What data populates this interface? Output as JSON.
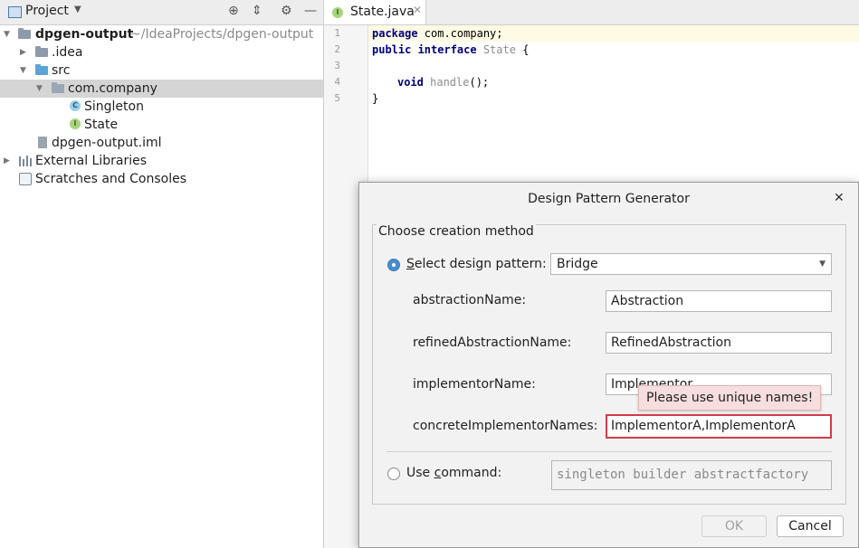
{
  "project_panel": {
    "title": "Project",
    "tree": [
      {
        "label": "dpgen-output",
        "path": "~/IdeaProjects/dpgen-output"
      },
      {
        "label": ".idea"
      },
      {
        "label": "src"
      },
      {
        "label": "com.company"
      },
      {
        "label": "Singleton",
        "badge": "C"
      },
      {
        "label": "State",
        "badge": "I"
      },
      {
        "label": "dpgen-output.iml"
      },
      {
        "label": "External Libraries"
      },
      {
        "label": "Scratches and Consoles"
      }
    ]
  },
  "editor": {
    "tab": {
      "label": "State.java",
      "badge": "I"
    },
    "line_numbers": [
      "1",
      "2",
      "3",
      "4",
      "5"
    ],
    "code": {
      "l1_kw": "package",
      "l1_rest": " com.company;",
      "l2_kw1": "public",
      "l2_kw2": " interface",
      "l2_name": " State",
      "l2_rest": " {",
      "l4_kw": "void",
      "l4_name": " handle",
      "l4_rest": "();",
      "l5": "}"
    }
  },
  "dialog": {
    "title": "Design Pattern Generator",
    "group_label": "Choose creation method",
    "select_pattern": {
      "mnemonic": "S",
      "label_rest": "elect design pattern:",
      "value": "Bridge",
      "selected": true
    },
    "fields": [
      {
        "label": "abstractionName:",
        "value": "Abstraction"
      },
      {
        "label": "refinedAbstractionName:",
        "value": "RefinedAbstraction"
      },
      {
        "label": "implementorName:",
        "value": "Implementor"
      },
      {
        "label": "concreteImplementorNames:",
        "value": "ImplementorA,ImplementorA"
      }
    ],
    "error_tooltip": "Please use unique names!",
    "use_command": {
      "label_pre": "Use ",
      "mnemonic": "c",
      "label_rest": "ommand:",
      "placeholder": "singleton builder abstractfactory",
      "selected": false
    },
    "buttons": {
      "ok": "OK",
      "cancel": "Cancel"
    }
  },
  "colors": {
    "accent": "#4a8bd0",
    "error": "#d23b4a",
    "tooltip_bg": "#f7dede",
    "selection": "#d5d5d5"
  }
}
